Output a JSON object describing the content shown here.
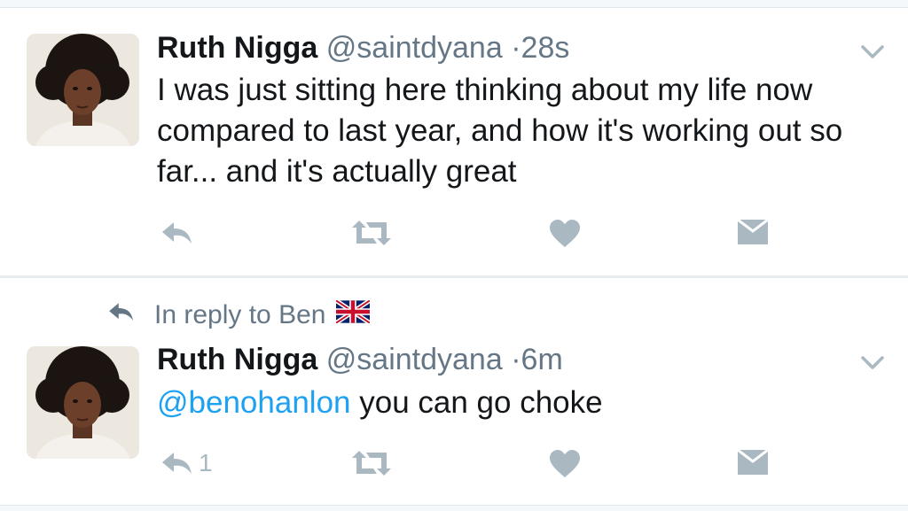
{
  "tweets": [
    {
      "author_name": "Ruth Nigga",
      "handle": "@saintdyana",
      "separator": "·",
      "time": "28s",
      "text": "I was just sitting here thinking about my life now compared to last year, and how it's working out so far... and it's actually great"
    },
    {
      "reply_context": "In reply to Ben",
      "reply_context_flag": "uk-flag-icon",
      "author_name": "Ruth Nigga",
      "handle": "@saintdyana",
      "separator": "·",
      "time": "6m",
      "mention": "@benohanlon",
      "text": " you can go choke",
      "reply_count": "1"
    }
  ],
  "icons": [
    "reply-icon",
    "retweet-icon",
    "like-icon",
    "direct-message-icon",
    "chevron-down-icon"
  ],
  "colors": {
    "name": "#14171a",
    "meta": "#657786",
    "mention": "#1da1f2",
    "action_icons": "#aab8c2"
  }
}
